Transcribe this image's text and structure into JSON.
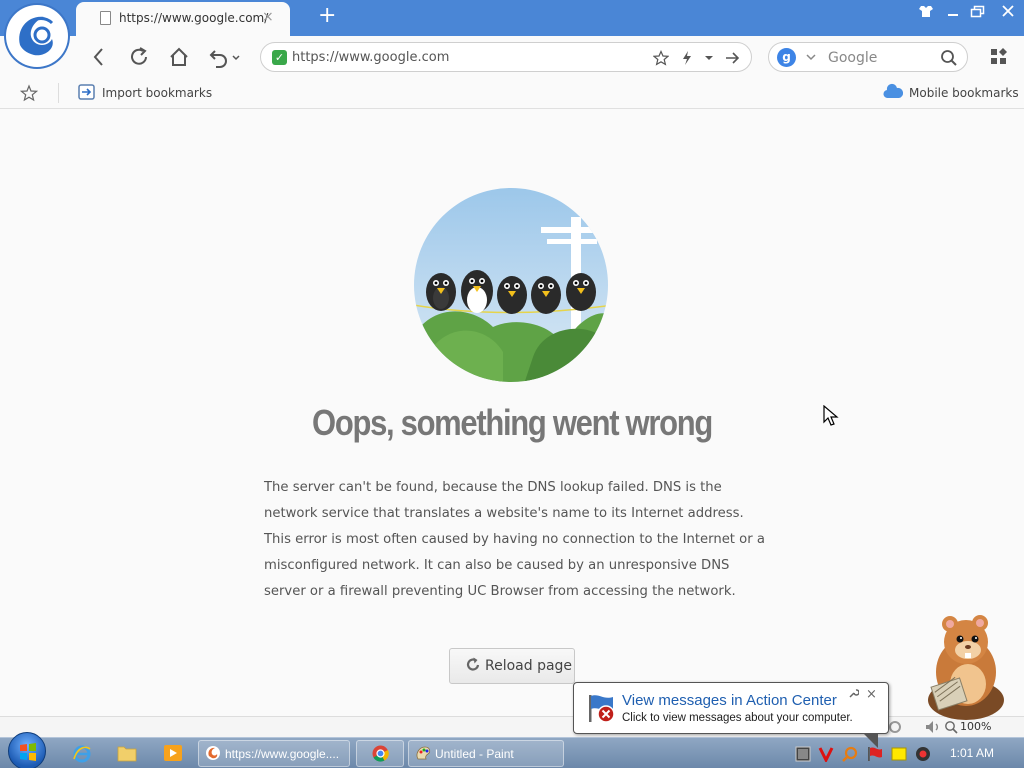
{
  "browser": {
    "tab": {
      "title": "https://www.google.com/",
      "close": "×"
    },
    "new_tab": "+",
    "address": {
      "url": "https://www.google.com"
    },
    "search": {
      "placeholder": "Google"
    },
    "bookmarks_bar": {
      "import_label": "Import bookmarks",
      "mobile_label": "Mobile bookmarks"
    }
  },
  "page": {
    "headline": "Oops, something went wrong",
    "message": "The server can't be found, because the DNS lookup failed. DNS is the network service that translates a website's name to its Internet address. This error is most often caused by having no connection to the Internet or a misconfigured network. It can also be caused by an unresponsive DNS server or a firewall preventing UC Browser from accessing the network.",
    "reload_label": "Reload page"
  },
  "statusbar": {
    "zoom": "100%"
  },
  "notification": {
    "title": "View messages in Action Center",
    "body": "Click to view messages about your computer.",
    "close": "×"
  },
  "taskbar": {
    "items": [
      {
        "label": "https://www.google...."
      },
      {
        "label": "Untitled - Paint"
      }
    ],
    "clock": "1:01 AM"
  },
  "colors": {
    "titlebar": "#4a86d6",
    "secure_green": "#3aa84a",
    "headline_gray": "#777777",
    "notification_link": "#1f5fb0"
  },
  "icons": [
    "uc-browser-logo-icon",
    "document-icon",
    "back-icon",
    "refresh-icon",
    "home-icon",
    "undo-icon",
    "star-icon",
    "lightning-icon",
    "arrow-right-icon",
    "search-icon",
    "grid-menu-icon",
    "import-icon",
    "cloud-icon",
    "reload-icon",
    "flag-icon",
    "windows-start-icon",
    "ie-icon",
    "folder-icon",
    "media-player-icon",
    "chrome-icon",
    "paint-icon",
    "speaker-icon",
    "zoom-icon"
  ]
}
